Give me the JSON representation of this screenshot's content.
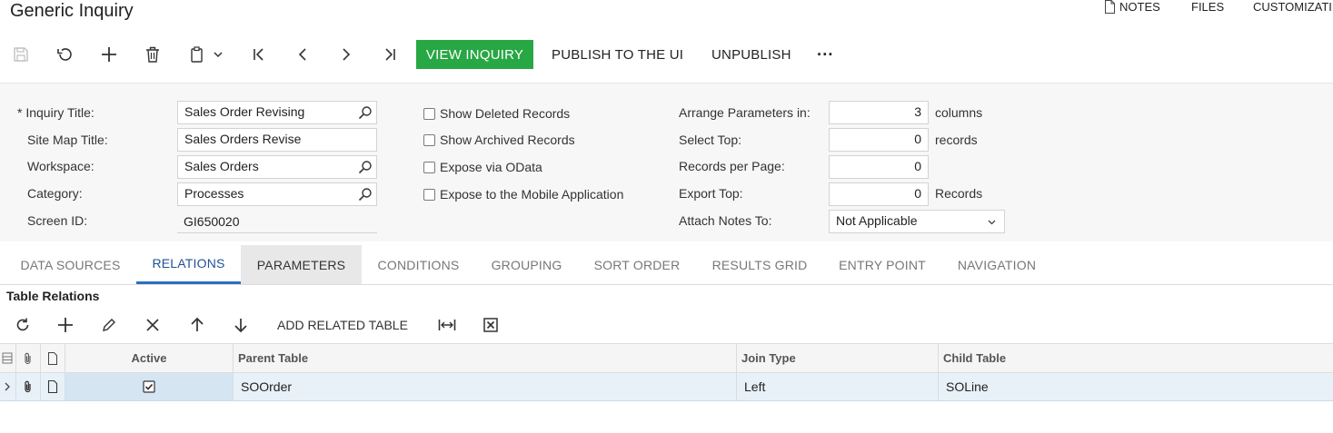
{
  "page": {
    "title": "Generic Inquiry"
  },
  "top_links": {
    "notes": "NOTES",
    "files": "FILES",
    "customization": "CUSTOMIZATI"
  },
  "toolbar": {
    "icons": [
      "save-icon",
      "undo-icon",
      "add-icon",
      "delete-icon",
      "copy-paste-icon",
      "first-record-icon",
      "previous-record-icon",
      "next-record-icon",
      "last-record-icon"
    ],
    "view_inquiry": "VIEW INQUIRY",
    "publish": "PUBLISH TO THE UI",
    "unpublish": "UNPUBLISH",
    "more": "···",
    "accent_color": "#28a745"
  },
  "form": {
    "inquiry_title": {
      "label": "Inquiry Title:",
      "required_marker": "*",
      "value": "Sales Order Revising"
    },
    "site_map_title": {
      "label": "Site Map Title:",
      "value": "Sales Orders Revise"
    },
    "workspace": {
      "label": "Workspace:",
      "value": "Sales Orders"
    },
    "category": {
      "label": "Category:",
      "value": "Processes"
    },
    "screen_id": {
      "label": "Screen ID:",
      "value": "GI650020"
    },
    "checkboxes": [
      {
        "label": "Show Deleted Records",
        "checked": false
      },
      {
        "label": "Show Archived Records",
        "checked": false
      },
      {
        "label": "Expose via OData",
        "checked": false
      },
      {
        "label": "Expose to the Mobile Application",
        "checked": false
      }
    ],
    "arrange_params": {
      "label": "Arrange Parameters in:",
      "value": "3",
      "unit": "columns"
    },
    "select_top": {
      "label": "Select Top:",
      "value": "0",
      "unit": "records"
    },
    "records_per_page": {
      "label": "Records per Page:",
      "value": "0"
    },
    "export_top": {
      "label": "Export Top:",
      "value": "0",
      "unit": "Records"
    },
    "attach_notes": {
      "label": "Attach Notes To:",
      "value": "Not Applicable"
    }
  },
  "tabs": [
    {
      "label": "DATA SOURCES",
      "state": "normal"
    },
    {
      "label": "RELATIONS",
      "state": "active"
    },
    {
      "label": "PARAMETERS",
      "state": "hover"
    },
    {
      "label": "CONDITIONS",
      "state": "normal"
    },
    {
      "label": "GROUPING",
      "state": "normal"
    },
    {
      "label": "SORT ORDER",
      "state": "normal"
    },
    {
      "label": "RESULTS GRID",
      "state": "normal"
    },
    {
      "label": "ENTRY POINT",
      "state": "normal"
    },
    {
      "label": "NAVIGATION",
      "state": "normal"
    }
  ],
  "relations": {
    "section_title": "Table Relations",
    "toolbar": {
      "add_related_table": "ADD RELATED TABLE"
    },
    "columns": [
      "Active",
      "Parent Table",
      "Join Type",
      "Child Table"
    ],
    "rows": [
      {
        "active": true,
        "parent_table": "SOOrder",
        "join_type": "Left",
        "child_table": "SOLine"
      }
    ]
  }
}
